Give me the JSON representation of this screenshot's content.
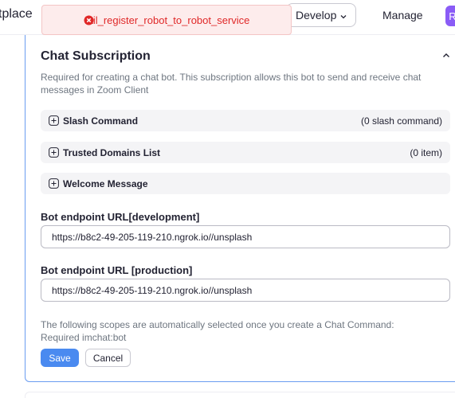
{
  "header": {
    "brand_fragment": "tplace",
    "develop_label": "Develop",
    "manage_label": "Manage",
    "avatar_initial": "R"
  },
  "toast": {
    "message": "fail_register_robot_to_robot_service",
    "icon": "error-circle-icon",
    "color": "#e02828"
  },
  "section": {
    "title": "Chat Subscription",
    "description": "Required for creating a chat bot. This subscription allows this bot to send and receive chat messages in Zoom Client",
    "expandables": [
      {
        "label": "Slash Command",
        "count": "(0 slash command)"
      },
      {
        "label": "Trusted Domains List",
        "count": "(0 item)"
      },
      {
        "label": "Welcome Message",
        "count": ""
      }
    ],
    "fields": [
      {
        "label": "Bot endpoint URL[development]",
        "value": "https://b8c2-49-205-119-210.ngrok.io//unsplash"
      },
      {
        "label": "Bot endpoint URL [production]",
        "value": "https://b8c2-49-205-119-210.ngrok.io//unsplash"
      }
    ],
    "note_line1": "The following scopes are automatically selected once you create a Chat Command:",
    "note_line2": "Required imchat:bot",
    "save_label": "Save",
    "cancel_label": "Cancel"
  },
  "colors": {
    "accent": "#4a8af0",
    "error_bg": "#fdecec",
    "card_border": "#6a9cf0"
  }
}
